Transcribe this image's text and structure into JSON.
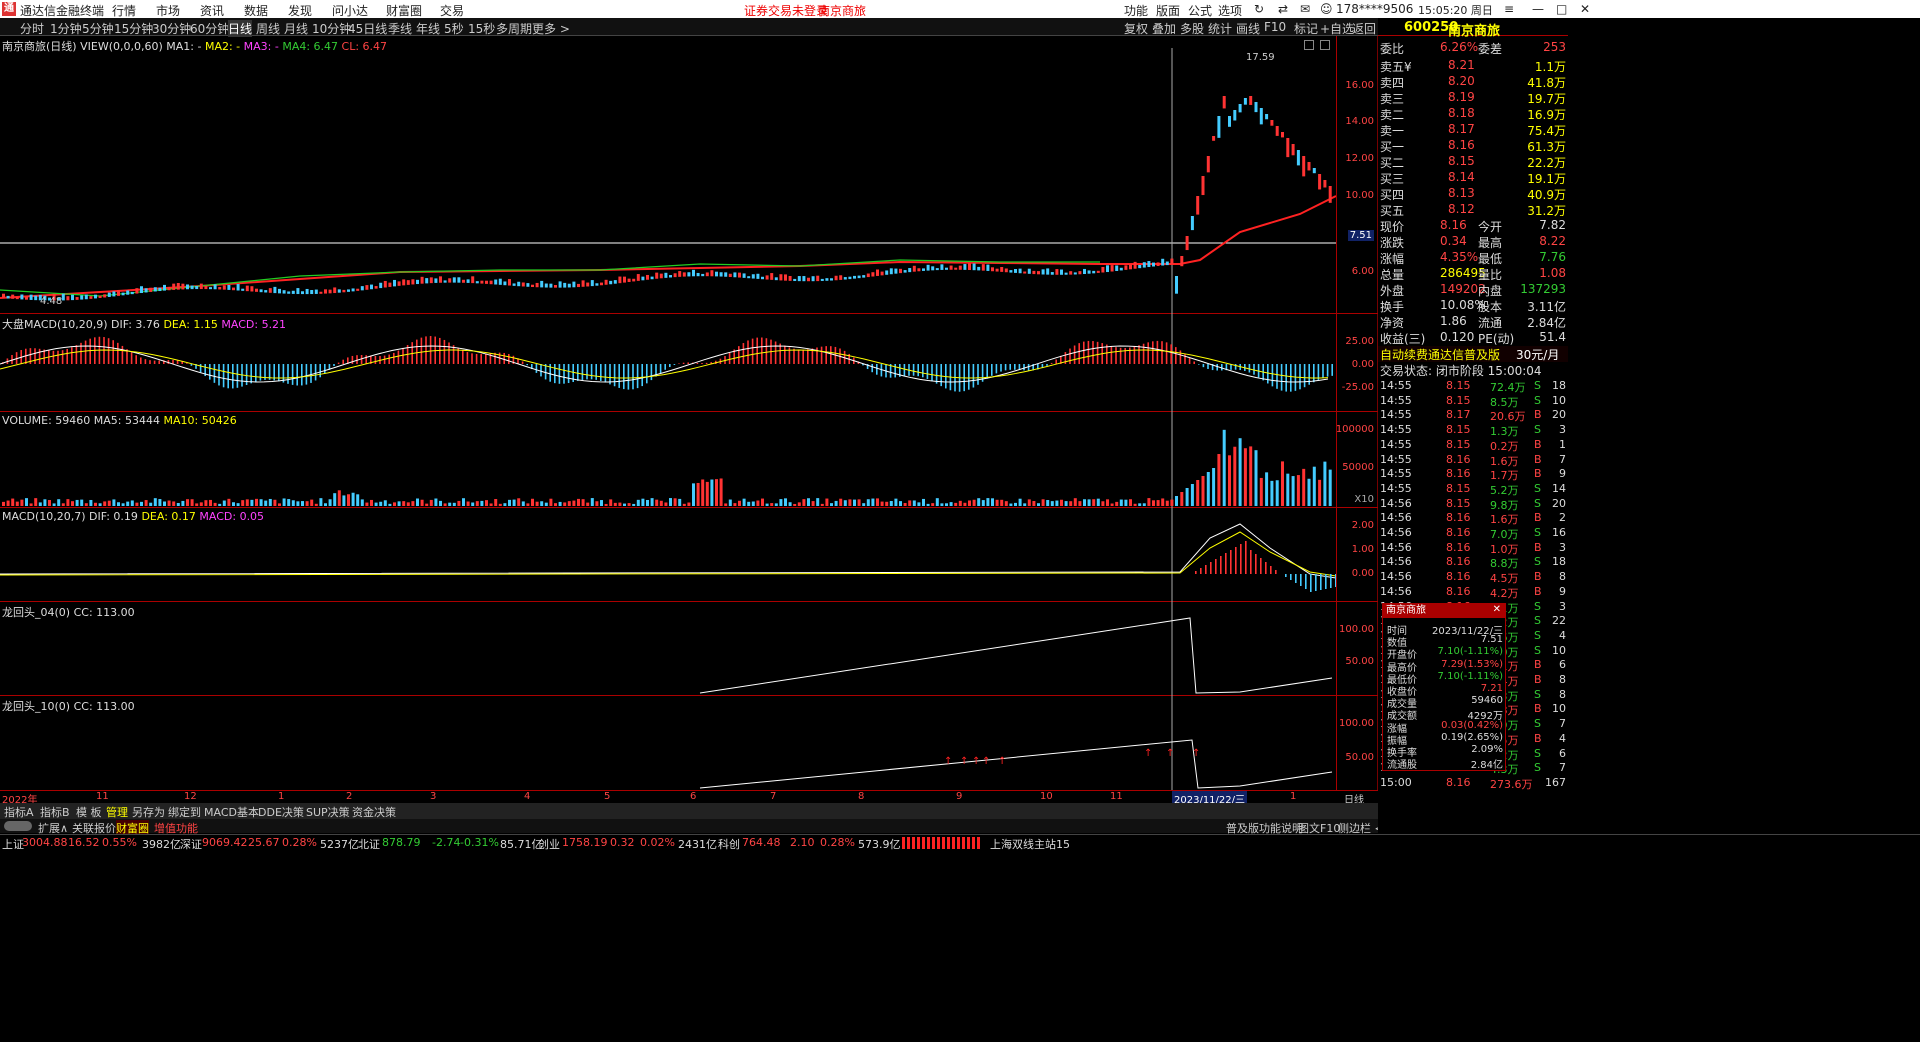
{
  "titlebar": {
    "app_name": "通达信金融终端",
    "menus": [
      "行情",
      "市场",
      "资讯",
      "数据",
      "发现",
      "问小达",
      "财富圈",
      "交易"
    ],
    "login_warning": "证券交易未登录",
    "stock_name": "南京商旅",
    "right_menus": [
      "功能",
      "版面",
      "公式",
      "选项"
    ],
    "account": "178****9506",
    "clock": "15:05:20 周日"
  },
  "periods": [
    "分时",
    "1分钟",
    "5分钟",
    "15分钟",
    "30分钟",
    "60分钟",
    "日线",
    "周线",
    "月线",
    "10分钟",
    "45日线",
    "季线",
    "年线",
    "5秒",
    "15秒",
    "多周期",
    "更多 >"
  ],
  "active_period": "日线",
  "toolbar": [
    "复权",
    "叠加",
    "多股",
    "统计",
    "画线",
    "F10",
    "标记",
    "+自选",
    "返回"
  ],
  "panels": {
    "main": {
      "title": "南京商旅(日线)",
      "indicator": "VIEW(0,0,0,60)",
      "ma1": "MA1: -",
      "ma2": "MA2: -",
      "ma3": "MA3: -",
      "ma4": "MA4: 6.47",
      "cl": "CL: 6.47",
      "high_label": "17.59",
      "low_label": "4.48",
      "price_line_label": "7.51",
      "yticks": [
        "16.00",
        "14.00",
        "12.00",
        "10.00",
        "8.00",
        "6.00"
      ]
    },
    "macd_big": {
      "title": "大盘MACD(10,20,9)",
      "dif": "DIF: 3.76",
      "dea": "DEA: 1.15",
      "macd": "MACD: 5.21",
      "yticks": [
        "25.00",
        "0.00",
        "-25.00"
      ]
    },
    "volume": {
      "title": "VOLUME: 59460",
      "ma5": "MA5: 53444",
      "ma10": "MA10: 50426",
      "yticks": [
        "100000",
        "50000"
      ],
      "unit": "X10"
    },
    "macd": {
      "title": "MACD(10,20,7)",
      "dif": "DIF: 0.19",
      "dea": "DEA: 0.17",
      "macd": "MACD: 0.05",
      "yticks": [
        "2.00",
        "1.00",
        "0.00"
      ]
    },
    "lht04": {
      "title": "龙回头_04(0)",
      "cc": "CC: 113.00",
      "yticks": [
        "100.00",
        "50.00"
      ]
    },
    "lht10": {
      "title": "龙回头_10(0)",
      "cc": "CC: 113.00",
      "yticks": [
        "100.00",
        "50.00"
      ]
    }
  },
  "xaxis": {
    "labels": [
      "2022年",
      "11",
      "12",
      "1",
      "2",
      "3",
      "4",
      "5",
      "6",
      "7",
      "8",
      "9",
      "10",
      "11",
      "1"
    ],
    "cursor_date": "2023/11/22/三",
    "period_label": "日线"
  },
  "bottom_tabs": [
    "指标A",
    "指标B",
    "模 板",
    "管理",
    "另存为",
    "绑定到",
    "MACD基本",
    "DDE决策",
    "SUP决策",
    "资金决策"
  ],
  "bottom_tabs2": [
    "扩展∧",
    "关联报价",
    "财富圈",
    "增值功能"
  ],
  "bottom_right": [
    "普及版功能说明",
    "图文F10",
    "侧边栏 <"
  ],
  "status": {
    "sh_label": "上证",
    "sh_val": "3004.88",
    "sh_chg": "16.52",
    "sh_pct": "0.55%",
    "sh_amt": "3982亿",
    "sz_label": "深证",
    "sz_val": "9069.42",
    "sz_chg": "25.67",
    "sz_pct": "0.28%",
    "sz_amt": "5237亿",
    "bz_label": "北证",
    "bz_val": "878.79",
    "bz_chg": "-2.74",
    "bz_pct": "-0.31%",
    "bz_amt": "85.71亿",
    "cy_label": "创业",
    "cy_val": "1758.19",
    "cy_chg": "0.32",
    "cy_pct": "0.02%",
    "cy_amt": "2431亿",
    "kc_label": "科创",
    "kc_val": "764.48",
    "kc_chg": "2.10",
    "kc_pct": "0.28%",
    "kc_amt": "573.9亿",
    "server": "上海双线主站15"
  },
  "quote": {
    "code": "600250",
    "name": "南京商旅",
    "weibi_label": "委比",
    "weibi": "6.26%",
    "weicha_label": "委差",
    "weicha": "253",
    "sells": [
      {
        "l": "卖五¥",
        "p": "8.21",
        "v": "1.1万"
      },
      {
        "l": "卖四",
        "p": "8.20",
        "v": "41.8万"
      },
      {
        "l": "卖三",
        "p": "8.19",
        "v": "19.7万"
      },
      {
        "l": "卖二",
        "p": "8.18",
        "v": "16.9万"
      },
      {
        "l": "卖一",
        "p": "8.17",
        "v": "75.4万"
      }
    ],
    "buys": [
      {
        "l": "买一",
        "p": "8.16",
        "v": "61.3万"
      },
      {
        "l": "买二",
        "p": "8.15",
        "v": "22.2万"
      },
      {
        "l": "买三",
        "p": "8.14",
        "v": "19.1万"
      },
      {
        "l": "买四",
        "p": "8.13",
        "v": "40.9万"
      },
      {
        "l": "买五",
        "p": "8.12",
        "v": "31.2万"
      }
    ],
    "stats": [
      {
        "a": "现价",
        "av": "8.16",
        "b": "今开",
        "bv": "7.82",
        "ac": "up",
        "bc": "wh"
      },
      {
        "a": "涨跌",
        "av": "0.34",
        "b": "最高",
        "bv": "8.22",
        "ac": "up",
        "bc": "up"
      },
      {
        "a": "涨幅",
        "av": "4.35%",
        "b": "最低",
        "bv": "7.76",
        "ac": "up",
        "bc": "dn"
      },
      {
        "a": "总量",
        "av": "286495",
        "b": "量比",
        "bv": "1.08",
        "ac": "yl",
        "bc": "up"
      },
      {
        "a": "外盘",
        "av": "149202",
        "b": "内盘",
        "bv": "137293",
        "ac": "up",
        "bc": "dn"
      },
      {
        "a": "换手",
        "av": "10.08%",
        "b": "股本",
        "bv": "3.11亿",
        "ac": "wh",
        "bc": "wh"
      },
      {
        "a": "净资",
        "av": "1.86",
        "b": "流通",
        "bv": "2.84亿",
        "ac": "wh",
        "bc": "wh"
      },
      {
        "a": "收益(三)",
        "av": "0.120",
        "b": "PE(动)",
        "bv": "51.4",
        "ac": "wh",
        "bc": "wh"
      }
    ],
    "promo": "自动续费通达信普及版",
    "promo_price": "30元/月",
    "trade_state": "交易状态: 闭市阶段 15:00:04",
    "ticks": [
      {
        "t": "14:55",
        "p": "8.15",
        "v": "72.4万",
        "d": "S",
        "n": "18"
      },
      {
        "t": "14:55",
        "p": "8.15",
        "v": "8.5万",
        "d": "S",
        "n": "10"
      },
      {
        "t": "14:55",
        "p": "8.17",
        "v": "20.6万",
        "d": "B",
        "n": "20"
      },
      {
        "t": "14:55",
        "p": "8.15",
        "v": "1.3万",
        "d": "S",
        "n": "3"
      },
      {
        "t": "14:55",
        "p": "8.15",
        "v": "0.2万",
        "d": "B",
        "n": "1"
      },
      {
        "t": "14:55",
        "p": "8.16",
        "v": "1.6万",
        "d": "B",
        "n": "7"
      },
      {
        "t": "14:55",
        "p": "8.16",
        "v": "1.7万",
        "d": "B",
        "n": "9"
      },
      {
        "t": "14:55",
        "p": "8.15",
        "v": "5.2万",
        "d": "S",
        "n": "14"
      },
      {
        "t": "14:56",
        "p": "8.15",
        "v": "9.8万",
        "d": "S",
        "n": "20"
      },
      {
        "t": "14:56",
        "p": "8.16",
        "v": "1.6万",
        "d": "B",
        "n": "2"
      },
      {
        "t": "14:56",
        "p": "8.16",
        "v": "7.0万",
        "d": "S",
        "n": "16"
      },
      {
        "t": "14:56",
        "p": "8.16",
        "v": "1.0万",
        "d": "B",
        "n": "3"
      },
      {
        "t": "14:56",
        "p": "8.16",
        "v": "8.8万",
        "d": "S",
        "n": "18"
      },
      {
        "t": "14:56",
        "p": "8.16",
        "v": "4.5万",
        "d": "B",
        "n": "8"
      },
      {
        "t": "14:56",
        "p": "8.16",
        "v": "4.2万",
        "d": "B",
        "n": "9"
      },
      {
        "t": "14:56",
        "p": "8.16",
        "v": "3.1万",
        "d": "S",
        "n": "3"
      },
      {
        "t": "14:56",
        "p": "8.16",
        "v": "2.2万",
        "d": "S",
        "n": "22"
      },
      {
        "t": "14:56",
        "p": "8.16",
        "v": "0.6万",
        "d": "S",
        "n": "4"
      },
      {
        "t": "14:56",
        "p": "8.16",
        "v": "5.0万",
        "d": "S",
        "n": "10"
      },
      {
        "t": "14:56",
        "p": "8.16",
        "v": "1.1万",
        "d": "B",
        "n": "6"
      },
      {
        "t": "14:56",
        "p": "8.16",
        "v": "2.4万",
        "d": "B",
        "n": "8"
      },
      {
        "t": "14:56",
        "p": "8.16",
        "v": "3.3万",
        "d": "S",
        "n": "8"
      },
      {
        "t": "14:56",
        "p": "8.16",
        "v": "0.8万",
        "d": "B",
        "n": "10"
      },
      {
        "t": "14:56",
        "p": "8.16",
        "v": "1.9万",
        "d": "S",
        "n": "7"
      },
      {
        "t": "14:57",
        "p": "8.16",
        "v": "0.5万",
        "d": "B",
        "n": "4"
      },
      {
        "t": "14:57",
        "p": "8.16",
        "v": "1.2万",
        "d": "S",
        "n": "6"
      },
      {
        "t": "14:57",
        "p": "8.16",
        "v": "4.3万",
        "d": "S",
        "n": "7"
      },
      {
        "t": "15:00",
        "p": "8.16",
        "v": "273.6万",
        "d": "",
        "n": "167"
      }
    ],
    "bottom_tabs": [
      "笔",
      "价",
      "细",
      "势",
      "联",
      "值",
      "主",
      "筹"
    ]
  },
  "popup": {
    "title": "南京商旅",
    "rows": [
      {
        "k": "时间",
        "v": "2023/11/22/三",
        "c": "wh"
      },
      {
        "k": "数值",
        "v": "7.51",
        "c": "wh"
      },
      {
        "k": "开盘价",
        "v": "7.10(-1.11%)",
        "c": "dn"
      },
      {
        "k": "最高价",
        "v": "7.29(1.53%)",
        "c": "up"
      },
      {
        "k": "最低价",
        "v": "7.10(-1.11%)",
        "c": "dn"
      },
      {
        "k": "收盘价",
        "v": "7.21",
        "c": "up"
      },
      {
        "k": "成交量",
        "v": "59460",
        "c": "wh"
      },
      {
        "k": "成交额",
        "v": "4292万",
        "c": "wh"
      },
      {
        "k": "涨幅",
        "v": "0.03(0.42%)",
        "c": "up"
      },
      {
        "k": "振幅",
        "v": "0.19(2.65%)",
        "c": "wh"
      },
      {
        "k": "换手率",
        "v": "2.09%",
        "c": "wh"
      },
      {
        "k": "流通股",
        "v": "2.84亿",
        "c": "wh"
      }
    ]
  }
}
